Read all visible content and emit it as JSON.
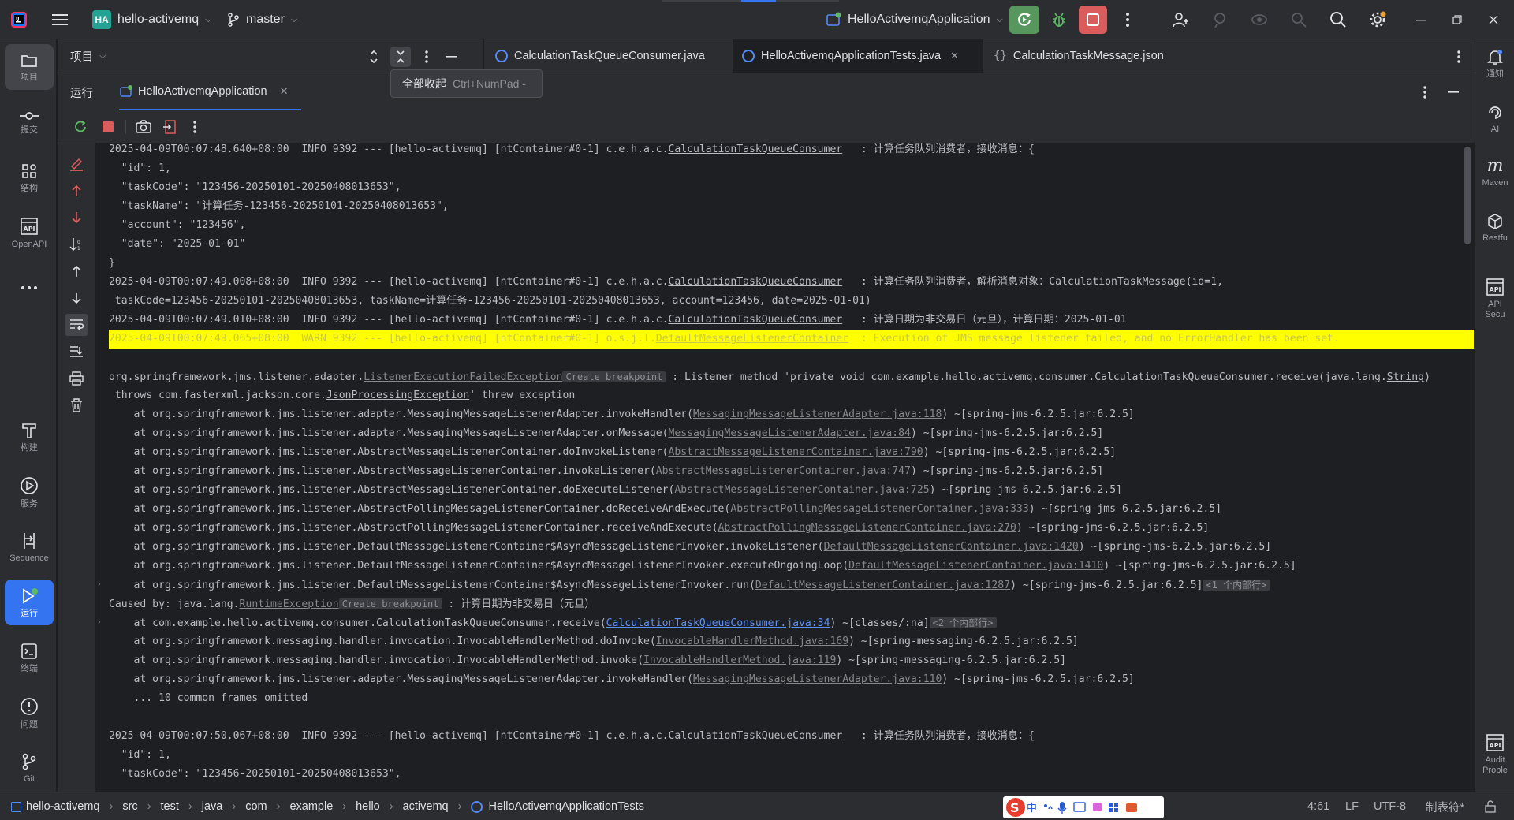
{
  "titlebar": {
    "project_badge": "HA",
    "project_name": "hello-activemq",
    "branch": "master",
    "run_config": "HelloActivemqApplication"
  },
  "left_strip": {
    "items": [
      {
        "label": "项目",
        "icon": "folder-icon"
      },
      {
        "label": "提交",
        "icon": "commit-icon"
      },
      {
        "label": "结构",
        "icon": "structure-icon"
      },
      {
        "label": "OpenAPI",
        "icon": "api-icon"
      },
      {
        "label": "构建",
        "icon": "hammer-icon"
      },
      {
        "label": "服务",
        "icon": "services-icon"
      },
      {
        "label": "Sequence",
        "icon": "sequence-icon"
      },
      {
        "label": "运行",
        "icon": "run-icon"
      },
      {
        "label": "终端",
        "icon": "terminal-icon"
      },
      {
        "label": "问题",
        "icon": "problems-icon"
      },
      {
        "label": "Git",
        "icon": "git-icon"
      }
    ]
  },
  "right_strip": {
    "items": [
      {
        "label": "通知",
        "icon": "bell-icon"
      },
      {
        "label": "AI",
        "icon": "ai-icon"
      },
      {
        "label": "Maven",
        "icon": "maven-icon"
      },
      {
        "label": "Restfu",
        "icon": "restful-icon"
      },
      {
        "label": "API Secu",
        "icon": "api-security-icon"
      },
      {
        "label": "Audit Proble",
        "icon": "audit-icon"
      }
    ]
  },
  "project_panel": {
    "title": "项目"
  },
  "editor_tabs": [
    {
      "label": "CalculationTaskQueueConsumer.java",
      "active": false
    },
    {
      "label": "HelloActivemqApplicationTests.java",
      "active": true
    },
    {
      "label": "CalculationTaskMessage.json",
      "active": false
    }
  ],
  "tooltip": {
    "label": "全部收起",
    "shortcut": "Ctrl+NumPad -"
  },
  "run_panel": {
    "title": "运行",
    "tab": "HelloActivemqApplication"
  },
  "console": {
    "lines": [
      {
        "t": "2025-04-09T00:07:48.640+08:00  INFO 9392 --- [hello-activemq] [ntContainer#0-1] c.e.h.a.c.",
        "cls": "CalculationTaskQueueConsumer",
        "rest": "   : 计算任务队列消费者，接收消息：{"
      },
      {
        "t": "  \"id\": 1,"
      },
      {
        "t": "  \"taskCode\": \"123456-20250101-20250408013653\","
      },
      {
        "t": "  \"taskName\": \"计算任务-123456-20250101-20250408013653\","
      },
      {
        "t": "  \"account\": \"123456\","
      },
      {
        "t": "  \"date\": \"2025-01-01\""
      },
      {
        "t": "}"
      },
      {
        "t": "2025-04-09T00:07:49.008+08:00  INFO 9392 --- [hello-activemq] [ntContainer#0-1] c.e.h.a.c.",
        "cls": "CalculationTaskQueueConsumer",
        "rest": "   : 计算任务队列消费者，解析消息对象：CalculationTaskMessage(id=1,"
      },
      {
        "t": " taskCode=123456-20250101-20250408013653, taskName=计算任务-123456-20250101-20250408013653, account=123456, date=2025-01-01)"
      },
      {
        "t": "2025-04-09T00:07:49.010+08:00  INFO 9392 --- [hello-activemq] [ntContainer#0-1] c.e.h.a.c.",
        "cls": "CalculationTaskQueueConsumer",
        "rest": "   : 计算日期为非交易日（元旦），计算日期：2025-01-01"
      },
      {
        "t": "2025-04-09T00:07:49.065+08:00  WARN 9392 --- [hello-activemq] [ntContainer#0-1] o.s.j.l.",
        "cls": "DefaultMessageListenerContainer",
        "rest": "  : Execution of JMS message listener failed, and no ErrorHandler has been set."
      },
      {
        "t": ""
      },
      {
        "t": "org.springframework.jms.listener.adapter.",
        "link": "ListenerExecutionFailedException",
        "hint": "Create breakpoint",
        "rest": " : Listener method 'private void com.example.hello.activemq.consumer.CalculationTaskQueueConsumer.receive(java.lang.",
        "link2": "String",
        "rest2": ")"
      },
      {
        "t": " throws com.fasterxml.jackson.core.",
        "cls": "JsonProcessingException",
        "rest": "' threw exception"
      },
      {
        "t": "    at org.springframework.jms.listener.adapter.MessagingMessageListenerAdapter.invokeHandler(",
        "link": "MessagingMessageListenerAdapter.java:118",
        "rest": ") ~[spring-jms-6.2.5.jar:6.2.5]"
      },
      {
        "t": "    at org.springframework.jms.listener.adapter.MessagingMessageListenerAdapter.onMessage(",
        "link": "MessagingMessageListenerAdapter.java:84",
        "rest": ") ~[spring-jms-6.2.5.jar:6.2.5]"
      },
      {
        "t": "    at org.springframework.jms.listener.AbstractMessageListenerContainer.doInvokeListener(",
        "link": "AbstractMessageListenerContainer.java:790",
        "rest": ") ~[spring-jms-6.2.5.jar:6.2.5]"
      },
      {
        "t": "    at org.springframework.jms.listener.AbstractMessageListenerContainer.invokeListener(",
        "link": "AbstractMessageListenerContainer.java:747",
        "rest": ") ~[spring-jms-6.2.5.jar:6.2.5]"
      },
      {
        "t": "    at org.springframework.jms.listener.AbstractMessageListenerContainer.doExecuteListener(",
        "link": "AbstractMessageListenerContainer.java:725",
        "rest": ") ~[spring-jms-6.2.5.jar:6.2.5]"
      },
      {
        "t": "    at org.springframework.jms.listener.AbstractPollingMessageListenerContainer.doReceiveAndExecute(",
        "link": "AbstractPollingMessageListenerContainer.java:333",
        "rest": ") ~[spring-jms-6.2.5.jar:6.2.5]"
      },
      {
        "t": "    at org.springframework.jms.listener.AbstractPollingMessageListenerContainer.receiveAndExecute(",
        "link": "AbstractPollingMessageListenerContainer.java:270",
        "rest": ") ~[spring-jms-6.2.5.jar:6.2.5]"
      },
      {
        "t": "    at org.springframework.jms.listener.DefaultMessageListenerContainer$AsyncMessageListenerInvoker.invokeListener(",
        "link": "DefaultMessageListenerContainer.java:1420",
        "rest": ") ~[spring-jms-6.2.5.jar:6.2.5]"
      },
      {
        "t": "    at org.springframework.jms.listener.DefaultMessageListenerContainer$AsyncMessageListenerInvoker.executeOngoingLoop(",
        "link": "DefaultMessageListenerContainer.java:1410",
        "rest": ") ~[spring-jms-6.2.5.jar:6.2.5]"
      },
      {
        "t": "    at org.springframework.jms.listener.DefaultMessageListenerContainer$AsyncMessageListenerInvoker.run(",
        "link": "DefaultMessageListenerContainer.java:1287",
        "rest": ") ~[spring-jms-6.2.5.jar:6.2.5]",
        "hint": "<1 个内部行>",
        "fold": true
      },
      {
        "t": "Caused by: java.lang.",
        "link": "RuntimeException",
        "hint": "Create breakpoint",
        "rest": " : 计算日期为非交易日（元旦）",
        "hintInline": true
      },
      {
        "t": "    at com.example.hello.activemq.consumer.CalculationTaskQueueConsumer.receive(",
        "bluelink": "CalculationTaskQueueConsumer.java:34",
        "rest": ") ~[classes/:na]",
        "hint": "<2 个内部行>",
        "fold": true
      },
      {
        "t": "    at org.springframework.messaging.handler.invocation.InvocableHandlerMethod.doInvoke(",
        "link": "InvocableHandlerMethod.java:169",
        "rest": ") ~[spring-messaging-6.2.5.jar:6.2.5]"
      },
      {
        "t": "    at org.springframework.messaging.handler.invocation.InvocableHandlerMethod.invoke(",
        "link": "InvocableHandlerMethod.java:119",
        "rest": ") ~[spring-messaging-6.2.5.jar:6.2.5]"
      },
      {
        "t": "    at org.springframework.jms.listener.adapter.MessagingMessageListenerAdapter.invokeHandler(",
        "link": "MessagingMessageListenerAdapter.java:110",
        "rest": ") ~[spring-jms-6.2.5.jar:6.2.5]"
      },
      {
        "t": "    ... 10 common frames omitted"
      },
      {
        "t": ""
      },
      {
        "t": "2025-04-09T00:07:50.067+08:00  INFO 9392 --- [hello-activemq] [ntContainer#0-1] c.e.h.a.c.",
        "cls": "CalculationTaskQueueConsumer",
        "rest": "   : 计算任务队列消费者，接收消息：{"
      },
      {
        "t": "  \"id\": 1,"
      },
      {
        "t": "  \"taskCode\": \"123456-20250101-20250408013653\","
      }
    ]
  },
  "statusbar": {
    "breadcrumb": [
      "hello-activemq",
      "src",
      "test",
      "java",
      "com",
      "example",
      "hello",
      "activemq",
      "HelloActivemqApplicationTests"
    ],
    "position": "4:61",
    "line_sep": "LF",
    "encoding": "UTF-8",
    "indent": "制表符*"
  },
  "colors": {
    "accent": "#3574f0",
    "run_green": "#57965c",
    "stop_red": "#db5c5c",
    "warn_highlight": "#ffff00"
  }
}
